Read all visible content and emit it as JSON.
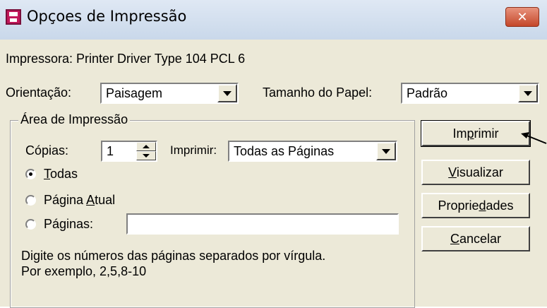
{
  "window": {
    "title": "Opçoes de Impressão",
    "close_label": "✕"
  },
  "printer": {
    "label": "Impressora: Printer Driver Type 104 PCL 6"
  },
  "orientation": {
    "label": "Orientação:",
    "value": "Paisagem"
  },
  "paper": {
    "label": "Tamanho do Papel:",
    "value": "Padrão"
  },
  "print_area": {
    "group_label": "Área de Impressão",
    "copies_label": "Cópias:",
    "copies_value": "1",
    "print_label": "Imprimir:",
    "print_value": "Todas as Páginas",
    "options": {
      "all": {
        "label": "Todas",
        "selected": true
      },
      "current": {
        "label": "Página Atual",
        "selected": false
      },
      "pages": {
        "label": "Páginas:",
        "selected": false,
        "value": ""
      }
    },
    "hint_line1": "Digite os números das páginas separados por vírgula.",
    "hint_line2": "Por exemplo, 2,5,8-10"
  },
  "buttons": {
    "print": "Imprimir",
    "preview": "Visualizar",
    "properties": "Propriedades",
    "cancel": "Cancelar"
  },
  "colors": {
    "dialog_bg": "#ece9d8",
    "close_button": "#c4472a",
    "app_icon": "#c2185b"
  }
}
